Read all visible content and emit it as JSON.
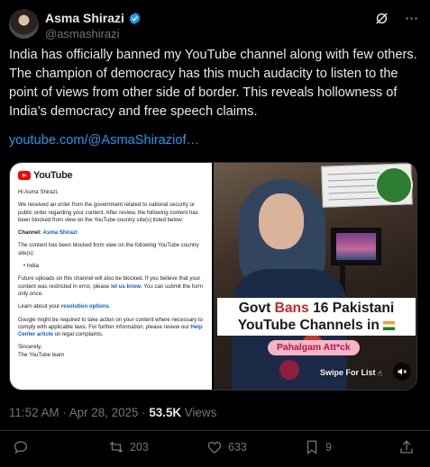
{
  "author": {
    "display_name": "Asma Shirazi",
    "handle": "@asmashirazi"
  },
  "tweet": {
    "text": "India has officially banned my YouTube channel along with few others. The champion of democracy has this much audacity to listen to the point of views from other side of border. This reveals  hollowness of India’s democracy and free speech claims.",
    "link": "youtube.com/@AsmaShiraziof…",
    "time": "11:52 AM · Apr 28, 2025 · ",
    "views_count": "53.5K",
    "views_label": " Views"
  },
  "media": {
    "left": {
      "logo_text": "YouTube",
      "greeting": "Hi Asma Shirazi,",
      "para1": "We received an order from the government related to national security or public order regarding your content. After review, the following content has been blocked from view on the YouTube country site(s) listed below:",
      "channel_label": "Channel:",
      "channel_name": " Asma Shirazi",
      "para2": "The content has been blocked from view on the following YouTube country site(s):",
      "country": "India",
      "para3a": "Future uploads on this channel will also be blocked. If you believe that your content was restricted in error, please ",
      "para3_link": "let us know",
      "para3b": ". You can submit the form only once.",
      "para4a": "Learn about your ",
      "para4_link": "resolution options",
      "para4b": ".",
      "para5a": "Google might be required to take action on your content where necessary to comply with applicable laws. For further information, please review our ",
      "para5_link": "Help Center article",
      "para5b": " on legal complaints.",
      "sign1": "Sincerely,",
      "sign2": "The YouTube team"
    },
    "right": {
      "title_part1": "Govt ",
      "title_red": "Bans",
      "title_part2": " 16 Pakistani",
      "title_line2": "YouTube Channels in ",
      "tag": "Pahalgam Att*ck",
      "swipe": "Swipe For List"
    }
  },
  "actions": {
    "reply_count": "",
    "retweet_count": "203",
    "like_count": "633",
    "bookmark_count": "9"
  },
  "colors": {
    "accent": "#1d9bf0",
    "background": "#000000",
    "muted": "#71767b"
  }
}
